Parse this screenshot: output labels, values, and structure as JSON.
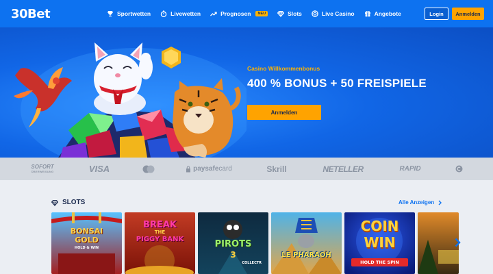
{
  "header": {
    "logo": "30Bet",
    "nav": [
      {
        "label": "Sportwetten",
        "icon": "trophy-icon"
      },
      {
        "label": "Livewetten",
        "icon": "stopwatch-icon"
      },
      {
        "label": "Prognosen",
        "icon": "trend-icon",
        "badge": "NEU"
      },
      {
        "label": "Slots",
        "icon": "diamond-icon"
      },
      {
        "label": "Live Casino",
        "icon": "casino-chip-icon"
      },
      {
        "label": "Angebote",
        "icon": "gift-icon"
      }
    ],
    "login_label": "Login",
    "register_label": "Anmelden"
  },
  "hero": {
    "subtitle": "Casino Willkommenbonus",
    "title": "400 % BONUS + 50 FREISPIELE",
    "cta_label": "Anmelden"
  },
  "payments": {
    "sofort": "SOFORT",
    "sofort_sub": "ÜBERWEISUNG",
    "visa": "VISA",
    "paysafe_a": "paysafe",
    "paysafe_b": "card",
    "skrill": "Skrill",
    "neteller": "NETELLER",
    "rapid": "RAPID"
  },
  "slots": {
    "title": "SLOTS",
    "see_all": "Alle Anzeigen",
    "games": [
      {
        "line1": "BONSAI",
        "line2": "GOLD",
        "line3": "HOLD & WIN"
      },
      {
        "line1": "BREAK",
        "line2": "THE",
        "line3": "PIGGY BANK"
      },
      {
        "line1": "PIROTS",
        "line2": "3",
        "line3": "COLLECTR"
      },
      {
        "line1": "LE PHARAOH",
        "line2": "",
        "line3": ""
      },
      {
        "line1": "COIN",
        "line2": "WIN",
        "line3": "HOLD THE SPIN"
      }
    ]
  },
  "colors": {
    "header": "#0d72f0",
    "accent": "#ffa300",
    "text_dark": "#1b2a4e",
    "badge": "#ffb400"
  }
}
